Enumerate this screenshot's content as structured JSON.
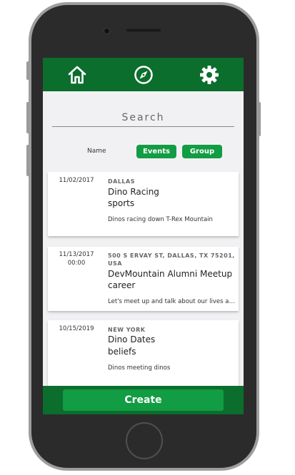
{
  "nav": {
    "icons": [
      "home-icon",
      "compass-icon",
      "gear-icon"
    ]
  },
  "search": {
    "placeholder": "Search",
    "value": ""
  },
  "filters": {
    "name_label": "Name",
    "events_label": "Events",
    "group_label": "Group"
  },
  "events": [
    {
      "date": "11/02/2017",
      "time": "",
      "location": "DALLAS",
      "title": "Dino Racing",
      "category": "sports",
      "description": "Dinos racing down T-Rex Mountain"
    },
    {
      "date": "11/13/2017",
      "time": "00:00",
      "location": "500 S ERVAY ST, DALLAS, TX 75201, USA",
      "title": "DevMountain Alumni Meetup",
      "category": "career",
      "description": "Let's meet up and talk about our lives after DevMountain"
    },
    {
      "date": "10/15/2019",
      "time": "",
      "location": "NEW YORK",
      "title": "Dino Dates",
      "category": "beliefs",
      "description": "Dinos meeting dinos"
    }
  ],
  "footer": {
    "create_label": "Create"
  },
  "colors": {
    "primary": "#0b6e2c",
    "accent": "#129c43",
    "screen_bg": "#f1f1f3"
  }
}
